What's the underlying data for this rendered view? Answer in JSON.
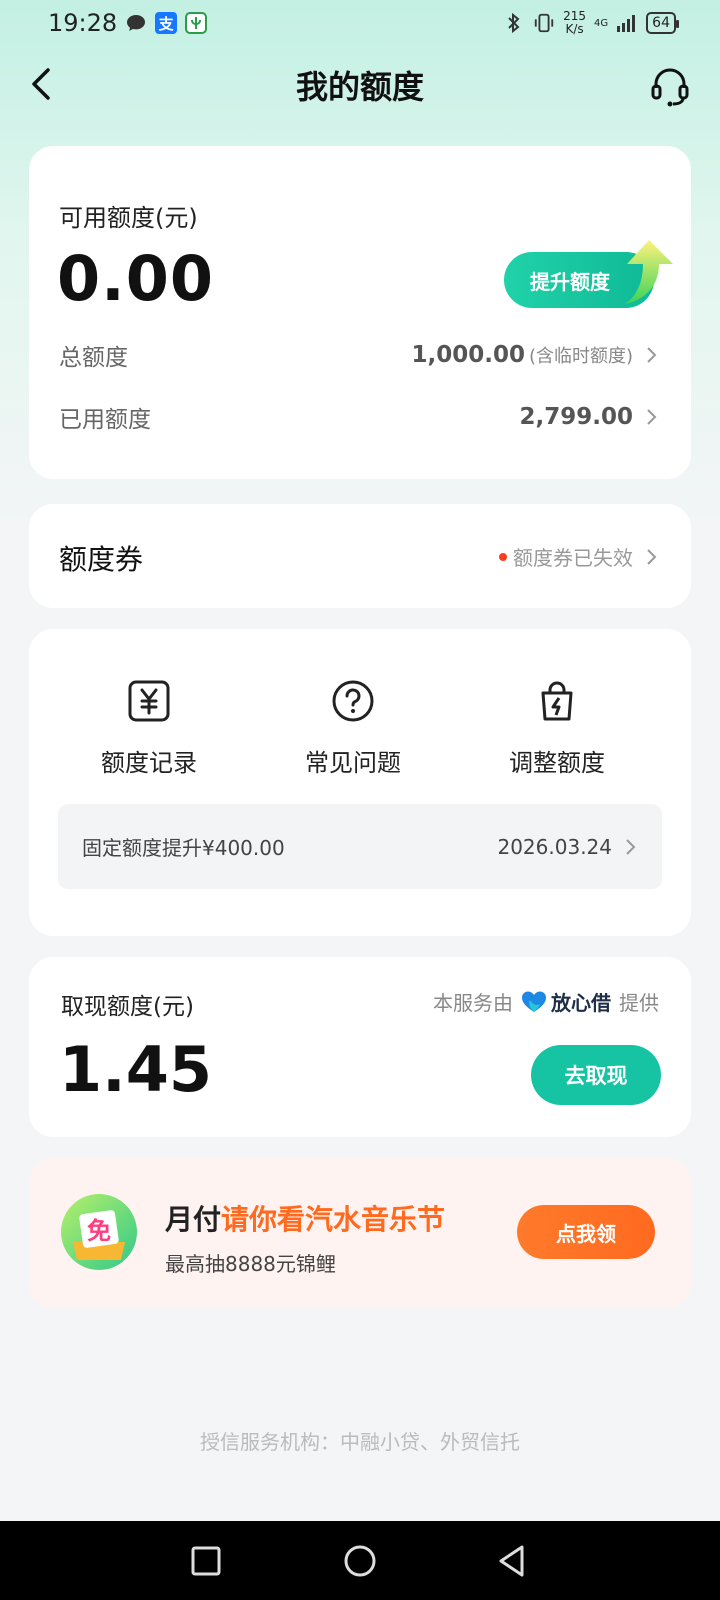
{
  "status_bar": {
    "time": "19:28",
    "alipay_glyph": "支",
    "speed_value": "215",
    "speed_unit": "K/s",
    "battery": "64",
    "signal_label": "4G"
  },
  "nav": {
    "title": "我的额度"
  },
  "credit": {
    "label": "可用额度(元)",
    "amount": "0.00",
    "raise_label": "提升额度",
    "total_label": "总额度",
    "total_value": "1,000.00",
    "total_note": "(含临时额度)",
    "used_label": "已用额度",
    "used_value": "2,799.00"
  },
  "coupon": {
    "title": "额度券",
    "status": "额度券已失效"
  },
  "menu": {
    "items": [
      {
        "label": "额度记录",
        "icon": "yen-doc-icon"
      },
      {
        "label": "常见问题",
        "icon": "question-icon"
      },
      {
        "label": "调整额度",
        "icon": "bag-bolt-icon"
      }
    ],
    "notice_text": "固定额度提升¥400.00",
    "notice_date": "2026.03.24"
  },
  "cash": {
    "label": "取现额度(元)",
    "provider_prefix": "本服务由",
    "provider_brand": "放心借",
    "provider_suffix": "提供",
    "amount": "1.45",
    "button": "去取现"
  },
  "promo": {
    "title_plain": "月付",
    "title_highlight": "请你看汽水音乐节",
    "subtitle": "最高抽8888元锦鲤",
    "button": "点我领",
    "icon_glyph": "免"
  },
  "footer": {
    "text": "授信服务机构：中融小贷、外贸信托"
  },
  "colors": {
    "accent": "#16c3a3",
    "promo_accent": "#ff6a1f",
    "alert_dot": "#ff3b1f"
  }
}
